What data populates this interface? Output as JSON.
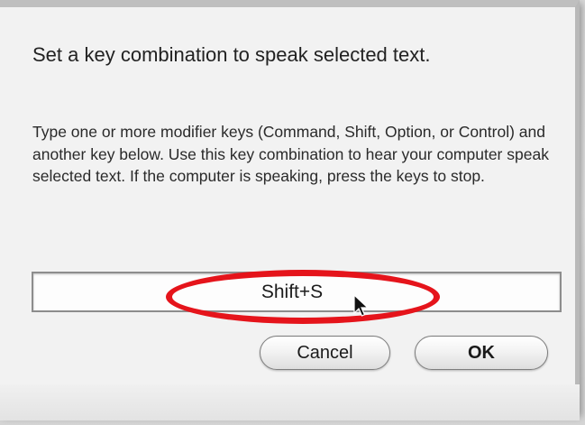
{
  "dialog": {
    "heading": "Set a key combination to speak selected text.",
    "description": "Type one or more modifier keys (Command, Shift, Option, or Control) and another key below. Use this key combination to hear your computer speak selected text. If the computer is speaking, press the keys to stop.",
    "key_field_value": "Shift+S",
    "cancel_label": "Cancel",
    "ok_label": "OK"
  },
  "annotation": {
    "ring_color": "#e5141b"
  },
  "icons": {
    "pointer": "mouse-pointer-icon"
  }
}
